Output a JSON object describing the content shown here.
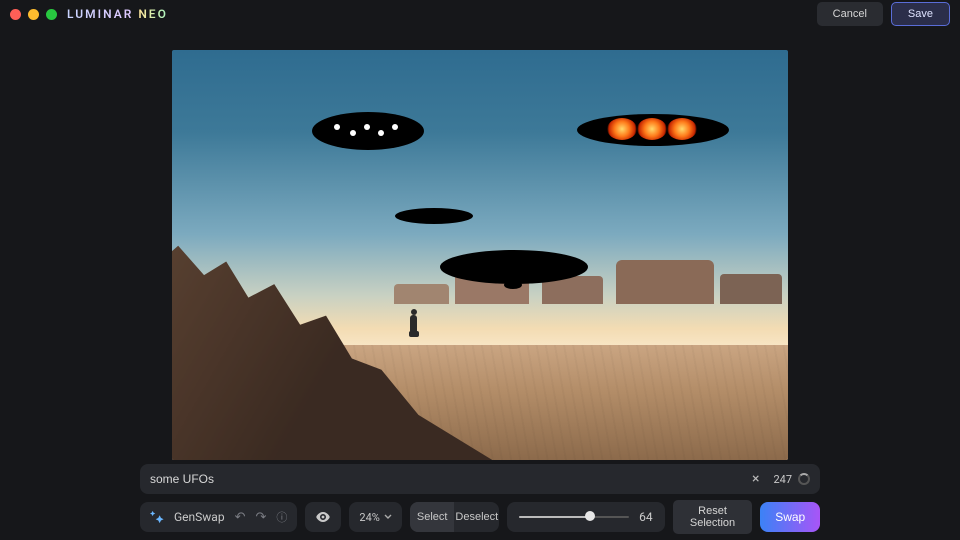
{
  "app": {
    "brand1": "LUMINAR",
    "brand2": "NEO"
  },
  "top": {
    "cancel": "Cancel",
    "save": "Save"
  },
  "prompt": {
    "value": "some UFOs",
    "count": "247"
  },
  "toolbar": {
    "genswap": "GenSwap",
    "zoom": "24%",
    "select": "Select",
    "deselect": "Deselect",
    "brush_size": "64",
    "brush_pct": 64,
    "reset": "Reset Selection",
    "swap": "Swap"
  }
}
